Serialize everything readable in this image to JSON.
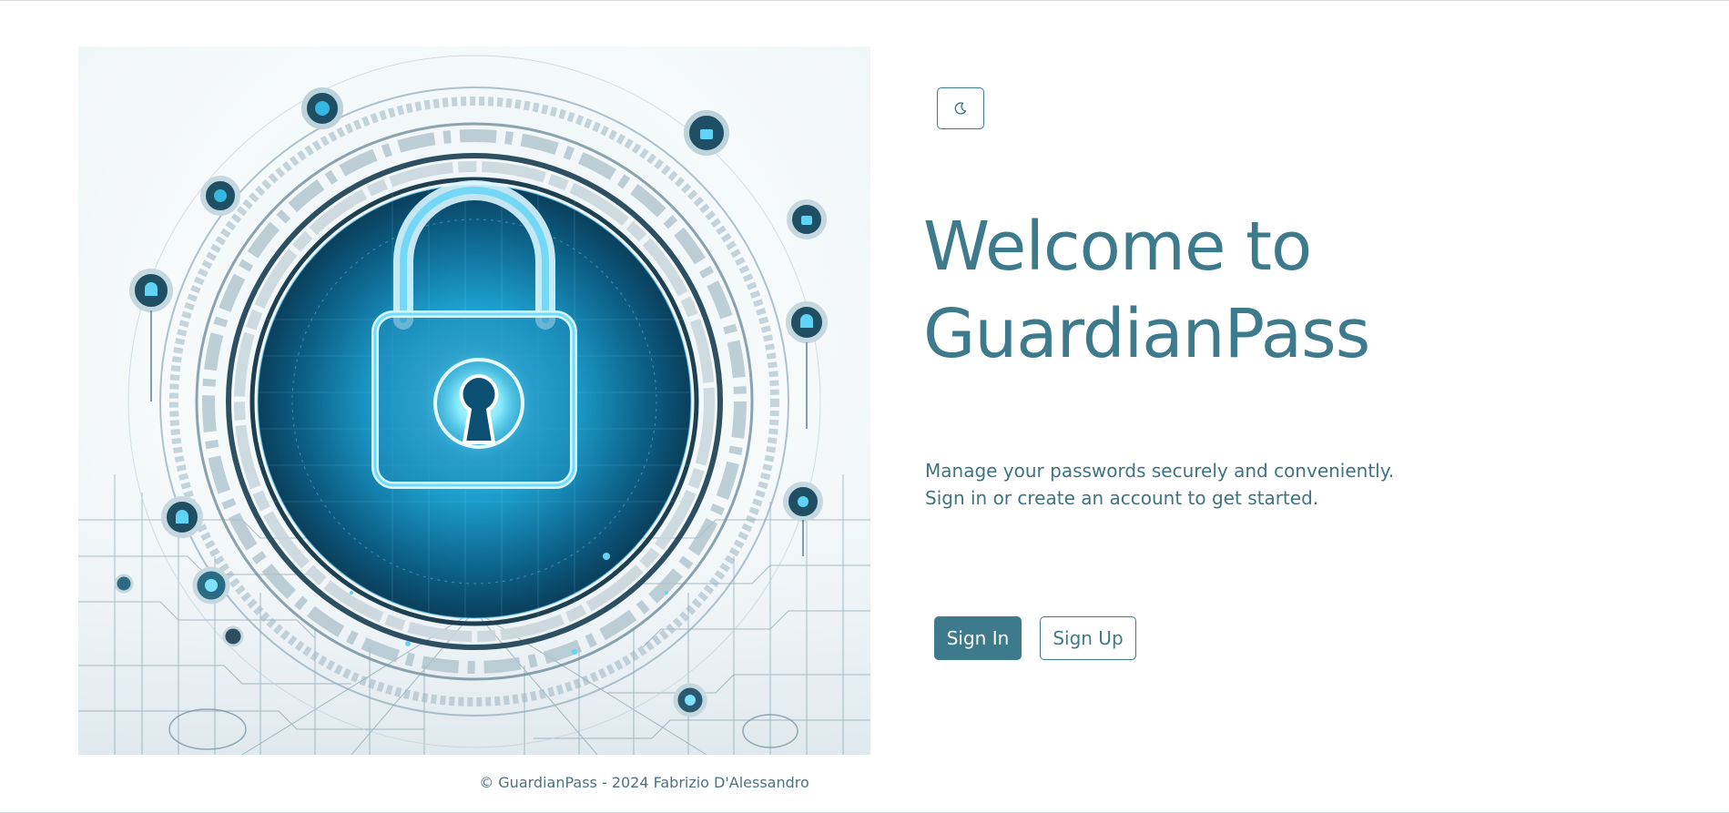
{
  "theme_toggle": {
    "icon": "moon-icon"
  },
  "hero": {
    "title_line1": "Welcome to",
    "title_line2": "GuardianPass",
    "description_line1": "Manage your passwords securely and conveniently.",
    "description_line2": "Sign in or create an account to get started.",
    "image_icon": "padlock-icon"
  },
  "actions": {
    "signin_label": "Sign In",
    "signup_label": "Sign Up"
  },
  "footer": {
    "text": "© GuardianPass - 2024 Fabrizio D'Alessandro"
  },
  "colors": {
    "accent": "#3d7a8b",
    "text_muted": "#4d7280",
    "background": "#ffffff",
    "lock_glow": "#29b6e8"
  }
}
